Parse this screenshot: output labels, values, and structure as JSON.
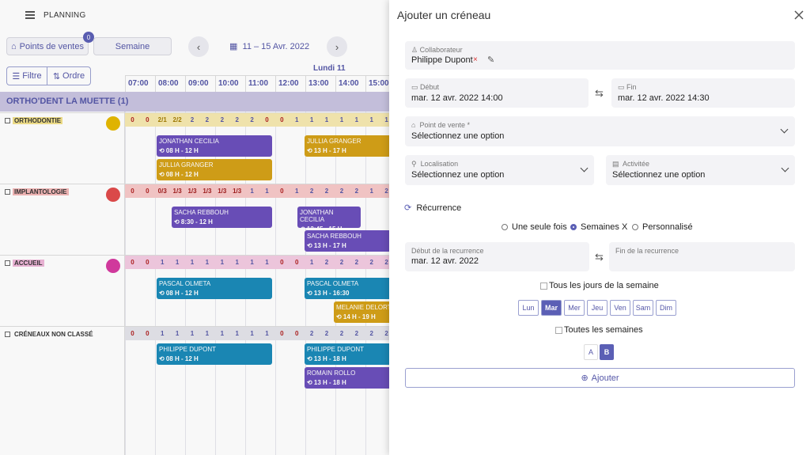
{
  "app": {
    "title": "PLANNING"
  },
  "toolbar": {
    "points_label": "Points de ventes",
    "points_badge": "0",
    "week_label": "Semaine",
    "date_range": "11 – 15 Avr. 2022",
    "filter_label": "Filtre",
    "order_label": "Ordre"
  },
  "calendar": {
    "day": "Lundi 11",
    "hours": [
      "07:00",
      "08:00",
      "09:00",
      "10:00",
      "11:00",
      "12:00",
      "13:00",
      "14:00",
      "15:00"
    ],
    "org": "ORTHO'DENT LA MUETTE (1)",
    "groups": [
      {
        "name": "ORTHODONTIE",
        "counts": [
          "0",
          "0",
          "2/1",
          "2/2",
          "2",
          "2",
          "2",
          "2",
          "2",
          "0",
          "0",
          "1",
          "1",
          "1",
          "1",
          "1",
          "1",
          "1"
        ]
      },
      {
        "name": "IMPLANTOLOGIE",
        "counts": [
          "0",
          "0",
          "0/3",
          "1/3",
          "1/3",
          "1/3",
          "1/3",
          "1/3",
          "1",
          "1",
          "0",
          "1",
          "2",
          "2",
          "2",
          "2",
          "1",
          "2"
        ]
      },
      {
        "name": "ACCUEIL",
        "counts": [
          "0",
          "0",
          "1",
          "1",
          "1",
          "1",
          "1",
          "1",
          "1",
          "1",
          "0",
          "0",
          "1",
          "2",
          "2",
          "2",
          "2",
          "2"
        ]
      },
      {
        "name": "CRÉNEAUX NON CLASSÉ",
        "counts": [
          "0",
          "0",
          "1",
          "1",
          "1",
          "1",
          "1",
          "1",
          "1",
          "1",
          "0",
          "0",
          "2",
          "2",
          "2",
          "2",
          "2",
          "2"
        ]
      }
    ],
    "cards": [
      {
        "name": "JONATHAN CECILIA",
        "time": "08 H - 12 H"
      },
      {
        "name": "JULLIA GRANGER",
        "time": "13 H - 17 H"
      },
      {
        "name": "JULLIA GRANGER",
        "time": "08 H - 12 H"
      },
      {
        "name": "SACHA REBBOUH",
        "time": "8:30 - 12 H"
      },
      {
        "name": "JONATHAN CECILIA",
        "time": "12:45 - 15 H"
      },
      {
        "name": "SACHA REBBOUH",
        "time": "13 H - 17 H"
      },
      {
        "name": "PASCAL OLMETA",
        "time": "08 H - 12 H"
      },
      {
        "name": "PASCAL OLMETA",
        "time": "13 H - 16:30"
      },
      {
        "name": "MELANIE DELORT",
        "time": "14 H - 19 H"
      },
      {
        "name": "PHILIPPE DUPONT",
        "time": "08 H - 12 H"
      },
      {
        "name": "PHILIPPE DUPONT",
        "time": "13 H - 18 H"
      },
      {
        "name": "ROMAIN ROLLO",
        "time": "13 H - 18 H"
      }
    ]
  },
  "panel": {
    "title": "Ajouter un créneau",
    "collaborateur_label": "Collaborateur",
    "collaborateur_value": "Philippe Dupont",
    "debut_label": "Début",
    "debut_value": "mar. 12 avr. 2022 14:00",
    "fin_label": "Fin",
    "fin_value": "mar. 12 avr. 2022 14:30",
    "pv_label": "Point de vente *",
    "pv_value": "Sélectionnez une option",
    "loc_label": "Localisation",
    "loc_value": "Sélectionnez une option",
    "act_label": "Activitée",
    "act_value": "Sélectionnez une option",
    "recurrence_title": "Récurrence",
    "radio_once": "Une seule fois",
    "radio_weeks": "Semaines X",
    "radio_custom": "Personnalisé",
    "rec_start_label": "Début de la recurrence",
    "rec_start_value": "mar. 12 avr. 2022",
    "rec_end_label": "Fin de la recurrence",
    "all_days_label": "Tous les jours de la semaine",
    "days": [
      "Lun",
      "Mar",
      "Mer",
      "Jeu",
      "Ven",
      "Sam",
      "Dim"
    ],
    "all_weeks_label": "Toutes les semaines",
    "week_a": "A",
    "week_b": "B",
    "add_label": "Ajouter"
  },
  "colors": {
    "accent": "#5b5fb5",
    "purple": "#6b4fbb",
    "gold": "#d4a017",
    "blue": "#1a8ab8"
  }
}
